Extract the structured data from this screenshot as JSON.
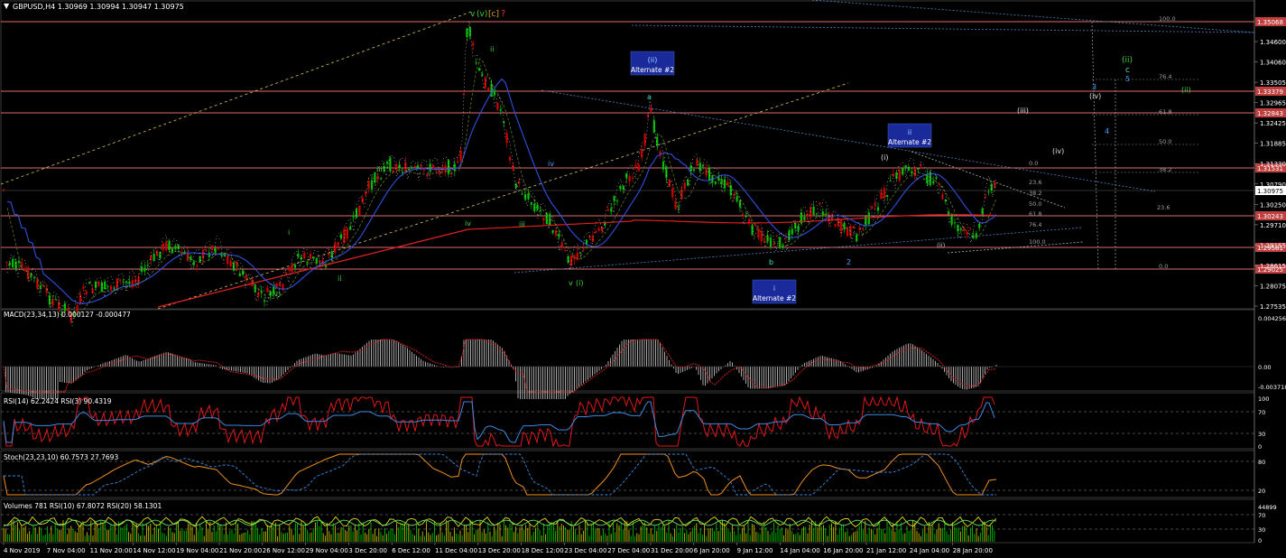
{
  "header": {
    "symbol_line": "GBPUSD,H4  1.30969 1.30994 1.30947 1.30975"
  },
  "price_axis": {
    "ticks": [
      "1.34600",
      "1.34060",
      "1.33505",
      "1.32965",
      "1.32425",
      "1.31885",
      "1.31330",
      "1.30790",
      "1.30250",
      "1.29710",
      "1.29155",
      "1.28615",
      "1.28075",
      "1.27535"
    ],
    "tags": [
      {
        "label": "1.35068",
        "color": "#c04040"
      },
      {
        "label": "1.33379",
        "color": "#c04040"
      },
      {
        "label": "1.32843",
        "color": "#c04040"
      },
      {
        "label": "1.31531",
        "color": "#c04040"
      },
      {
        "label": "1.30975",
        "color": "#ffffff"
      },
      {
        "label": "1.30243",
        "color": "#c04040"
      },
      {
        "label": "1.29581",
        "color": "#c04040"
      },
      {
        "label": "1.29025",
        "color": "#c04040"
      }
    ]
  },
  "wave_labels": {
    "top_v": "v",
    "top_vv": "(v)",
    "top_c": "[c]",
    "top_q": "?",
    "top_ii": "ii",
    "iv_left": "iv",
    "iv_mid": "iv",
    "iii_left": "iii",
    "iii_mid": "iii",
    "i_left": "i",
    "ii_left": "ii",
    "iv_paren": "(iv)",
    "v_i": "v",
    "v_i2": "(i)",
    "a_label": "a",
    "b_label": "b",
    "n2_label": "2",
    "i_paren": "(i)",
    "ii_paren_small": "(ii)",
    "iii_paren": "(iii)",
    "iv_paren_r": "(iv)",
    "iv_paren_r2": "(iv)",
    "n3": "3",
    "n4": "4",
    "n5": "5",
    "c_label": "c",
    "ii_green": "(ii)",
    "ii_green2": "(ii)"
  },
  "boxes": {
    "alt_ii": {
      "l1": "(ii)",
      "l2": "Alternate #2"
    },
    "alt_ii_right": {
      "l1": "ii",
      "l2": "Alternate #2"
    },
    "alt_i": {
      "l1": "i",
      "l2": "Alternate #2"
    }
  },
  "fib_right": {
    "levels": [
      "100.0",
      "76.4",
      "61.8",
      "50.0",
      "38.2",
      "0.0"
    ]
  },
  "fib_mid": {
    "levels": [
      "0.0",
      "23.6",
      "38.2",
      "50.0",
      "61.8",
      "76.4",
      "100.0",
      "23.6"
    ]
  },
  "macd": {
    "label": "MACD(23,34,13) 0.000127 -0.000477",
    "ticks": [
      "0.004256",
      "0.00",
      "-0.003718"
    ]
  },
  "rsi": {
    "label": "RSI(14) 62.2424  RSI(3) 90.4319",
    "ticks": [
      "100",
      "70",
      "30",
      "0"
    ]
  },
  "stoch": {
    "label": "Stoch(23,23,10) 60.7573 27.7693",
    "ticks": [
      "80",
      "20"
    ]
  },
  "volumes": {
    "label": "Volumes 781  RSI(10) 67.8072  RSI(20) 58.1301",
    "ticks": [
      "44899",
      "70",
      "30",
      "0"
    ]
  },
  "time_axis": [
    "4 Nov 2019",
    "7 Nov 04:00",
    "11 Nov 20:00",
    "14 Nov 12:00",
    "19 Nov 04:00",
    "21 Nov 20:00",
    "26 Nov 12:00",
    "29 Nov 04:00",
    "3 Dec 20:00",
    "6 Dec 12:00",
    "11 Dec 04:00",
    "13 Dec 20:00",
    "18 Dec 12:00",
    "23 Dec 04:00",
    "27 Dec 04:00",
    "31 Dec 20:00",
    "6 Jan 20:00",
    "9 Jan 12:00",
    "14 Jan 04:00",
    "16 Jan 20:00",
    "21 Jan 12:00",
    "24 Jan 04:00",
    "28 Jan 20:00"
  ],
  "colors": {
    "bull": "#00c000",
    "bear": "#c00000",
    "hline": "#e06060",
    "blue_box": "#1a2a9a",
    "grid": "#404040"
  }
}
